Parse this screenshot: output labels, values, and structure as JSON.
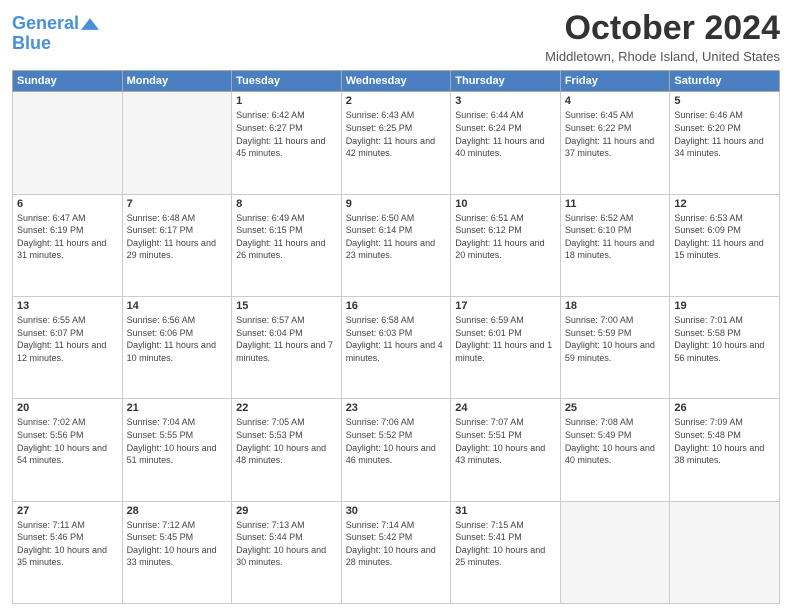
{
  "header": {
    "logo_line1": "General",
    "logo_line2": "Blue",
    "month_title": "October 2024",
    "location": "Middletown, Rhode Island, United States"
  },
  "weekdays": [
    "Sunday",
    "Monday",
    "Tuesday",
    "Wednesday",
    "Thursday",
    "Friday",
    "Saturday"
  ],
  "weeks": [
    [
      {
        "num": "",
        "info": ""
      },
      {
        "num": "",
        "info": ""
      },
      {
        "num": "1",
        "info": "Sunrise: 6:42 AM\nSunset: 6:27 PM\nDaylight: 11 hours and 45 minutes."
      },
      {
        "num": "2",
        "info": "Sunrise: 6:43 AM\nSunset: 6:25 PM\nDaylight: 11 hours and 42 minutes."
      },
      {
        "num": "3",
        "info": "Sunrise: 6:44 AM\nSunset: 6:24 PM\nDaylight: 11 hours and 40 minutes."
      },
      {
        "num": "4",
        "info": "Sunrise: 6:45 AM\nSunset: 6:22 PM\nDaylight: 11 hours and 37 minutes."
      },
      {
        "num": "5",
        "info": "Sunrise: 6:46 AM\nSunset: 6:20 PM\nDaylight: 11 hours and 34 minutes."
      }
    ],
    [
      {
        "num": "6",
        "info": "Sunrise: 6:47 AM\nSunset: 6:19 PM\nDaylight: 11 hours and 31 minutes."
      },
      {
        "num": "7",
        "info": "Sunrise: 6:48 AM\nSunset: 6:17 PM\nDaylight: 11 hours and 29 minutes."
      },
      {
        "num": "8",
        "info": "Sunrise: 6:49 AM\nSunset: 6:15 PM\nDaylight: 11 hours and 26 minutes."
      },
      {
        "num": "9",
        "info": "Sunrise: 6:50 AM\nSunset: 6:14 PM\nDaylight: 11 hours and 23 minutes."
      },
      {
        "num": "10",
        "info": "Sunrise: 6:51 AM\nSunset: 6:12 PM\nDaylight: 11 hours and 20 minutes."
      },
      {
        "num": "11",
        "info": "Sunrise: 6:52 AM\nSunset: 6:10 PM\nDaylight: 11 hours and 18 minutes."
      },
      {
        "num": "12",
        "info": "Sunrise: 6:53 AM\nSunset: 6:09 PM\nDaylight: 11 hours and 15 minutes."
      }
    ],
    [
      {
        "num": "13",
        "info": "Sunrise: 6:55 AM\nSunset: 6:07 PM\nDaylight: 11 hours and 12 minutes."
      },
      {
        "num": "14",
        "info": "Sunrise: 6:56 AM\nSunset: 6:06 PM\nDaylight: 11 hours and 10 minutes."
      },
      {
        "num": "15",
        "info": "Sunrise: 6:57 AM\nSunset: 6:04 PM\nDaylight: 11 hours and 7 minutes."
      },
      {
        "num": "16",
        "info": "Sunrise: 6:58 AM\nSunset: 6:03 PM\nDaylight: 11 hours and 4 minutes."
      },
      {
        "num": "17",
        "info": "Sunrise: 6:59 AM\nSunset: 6:01 PM\nDaylight: 11 hours and 1 minute."
      },
      {
        "num": "18",
        "info": "Sunrise: 7:00 AM\nSunset: 5:59 PM\nDaylight: 10 hours and 59 minutes."
      },
      {
        "num": "19",
        "info": "Sunrise: 7:01 AM\nSunset: 5:58 PM\nDaylight: 10 hours and 56 minutes."
      }
    ],
    [
      {
        "num": "20",
        "info": "Sunrise: 7:02 AM\nSunset: 5:56 PM\nDaylight: 10 hours and 54 minutes."
      },
      {
        "num": "21",
        "info": "Sunrise: 7:04 AM\nSunset: 5:55 PM\nDaylight: 10 hours and 51 minutes."
      },
      {
        "num": "22",
        "info": "Sunrise: 7:05 AM\nSunset: 5:53 PM\nDaylight: 10 hours and 48 minutes."
      },
      {
        "num": "23",
        "info": "Sunrise: 7:06 AM\nSunset: 5:52 PM\nDaylight: 10 hours and 46 minutes."
      },
      {
        "num": "24",
        "info": "Sunrise: 7:07 AM\nSunset: 5:51 PM\nDaylight: 10 hours and 43 minutes."
      },
      {
        "num": "25",
        "info": "Sunrise: 7:08 AM\nSunset: 5:49 PM\nDaylight: 10 hours and 40 minutes."
      },
      {
        "num": "26",
        "info": "Sunrise: 7:09 AM\nSunset: 5:48 PM\nDaylight: 10 hours and 38 minutes."
      }
    ],
    [
      {
        "num": "27",
        "info": "Sunrise: 7:11 AM\nSunset: 5:46 PM\nDaylight: 10 hours and 35 minutes."
      },
      {
        "num": "28",
        "info": "Sunrise: 7:12 AM\nSunset: 5:45 PM\nDaylight: 10 hours and 33 minutes."
      },
      {
        "num": "29",
        "info": "Sunrise: 7:13 AM\nSunset: 5:44 PM\nDaylight: 10 hours and 30 minutes."
      },
      {
        "num": "30",
        "info": "Sunrise: 7:14 AM\nSunset: 5:42 PM\nDaylight: 10 hours and 28 minutes."
      },
      {
        "num": "31",
        "info": "Sunrise: 7:15 AM\nSunset: 5:41 PM\nDaylight: 10 hours and 25 minutes."
      },
      {
        "num": "",
        "info": ""
      },
      {
        "num": "",
        "info": ""
      }
    ]
  ]
}
